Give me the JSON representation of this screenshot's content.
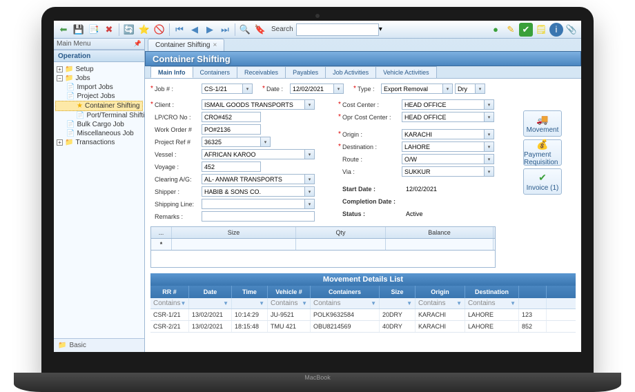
{
  "search_label": "Search",
  "sidebar": {
    "header": "Main Menu",
    "panel": "Operation",
    "items": [
      {
        "label": "Setup"
      },
      {
        "label": "Jobs"
      },
      {
        "label": "Import Jobs"
      },
      {
        "label": "Project Jobs"
      },
      {
        "label": "Container Shifting"
      },
      {
        "label": "Port/Terminal Shifting"
      },
      {
        "label": "Bulk Cargo Job"
      },
      {
        "label": "Miscellaneous Job"
      },
      {
        "label": "Transactions"
      }
    ],
    "footer": "Basic"
  },
  "tab": {
    "label": "Container Shifting"
  },
  "title": "Container Shifting",
  "subtabs": [
    "Main Info",
    "Containers",
    "Receivables",
    "Payables",
    "Job Activities",
    "Vehicle Activities"
  ],
  "top": {
    "job_lbl": "Job # :",
    "job_val": "CS-1/21",
    "date_lbl": "Date :",
    "date_val": "12/02/2021",
    "type_lbl": "Type :",
    "type_val": "Export Removal",
    "type2": "Dry"
  },
  "left": {
    "client_lbl": "Client :",
    "client_val": "ISMAIL GOODS TRANSPORTS",
    "lpcro_lbl": "LP/CRO No :",
    "lpcro_val": "CRO#452",
    "wo_lbl": "Work Order #",
    "wo_val": "PO#2136",
    "pref_lbl": "Project Ref #",
    "pref_val": "36325",
    "vessel_lbl": "Vessel :",
    "vessel_val": "AFRICAN KAROO",
    "voy_lbl": "Voyage :",
    "voy_val": "452",
    "clr_lbl": "Clearing A/G:",
    "clr_val": "AL- ANWAR TRANSPORTS",
    "shp_lbl": "Shipper :",
    "shp_val": "HABIB & SONS CO.",
    "line_lbl": "Shipping Line:",
    "line_val": "",
    "rem_lbl": "Remarks :",
    "rem_val": ""
  },
  "right": {
    "cc_lbl": "Cost Center :",
    "cc_val": "HEAD OFFICE",
    "occ_lbl": "Opr Cost Center :",
    "occ_val": "HEAD OFFICE",
    "org_lbl": "Origin :",
    "org_val": "KARACHI",
    "dst_lbl": "Destination :",
    "dst_val": "LAHORE",
    "rt_lbl": "Route :",
    "rt_val": "O/W",
    "via_lbl": "Via :",
    "via_val": "SUKKUR",
    "sd_lbl": "Start Date :",
    "sd_val": "12/02/2021",
    "cd_lbl": "Completion Date :",
    "cd_val": "",
    "st_lbl": "Status :",
    "st_val": "Active"
  },
  "actions": {
    "movement": "Movement",
    "payreq": "Payment Requisition",
    "invoice": "Invoice (1)"
  },
  "grid": {
    "h1": "...",
    "h2": "Size",
    "h3": "Qty",
    "h4": "Balance"
  },
  "mvt": {
    "title": "Movement Details List",
    "hdr": [
      "RR #",
      "Date",
      "Time",
      "Vehicle #",
      "Containers",
      "Size",
      "Origin",
      "Destination",
      ""
    ],
    "filter": "Contains",
    "rows": [
      {
        "rr": "CSR-1/21",
        "date": "13/02/2021",
        "time": "10:14:29",
        "veh": "JU-9521",
        "cont": "POLK9632584",
        "size": "20DRY",
        "org": "KARACHI",
        "dst": "LAHORE",
        "x": "123"
      },
      {
        "rr": "CSR-2/21",
        "date": "13/02/2021",
        "time": "18:15:48",
        "veh": "TMU 421",
        "cont": "OBU8214569",
        "size": "40DRY",
        "org": "KARACHI",
        "dst": "LAHORE",
        "x": "852"
      }
    ]
  }
}
